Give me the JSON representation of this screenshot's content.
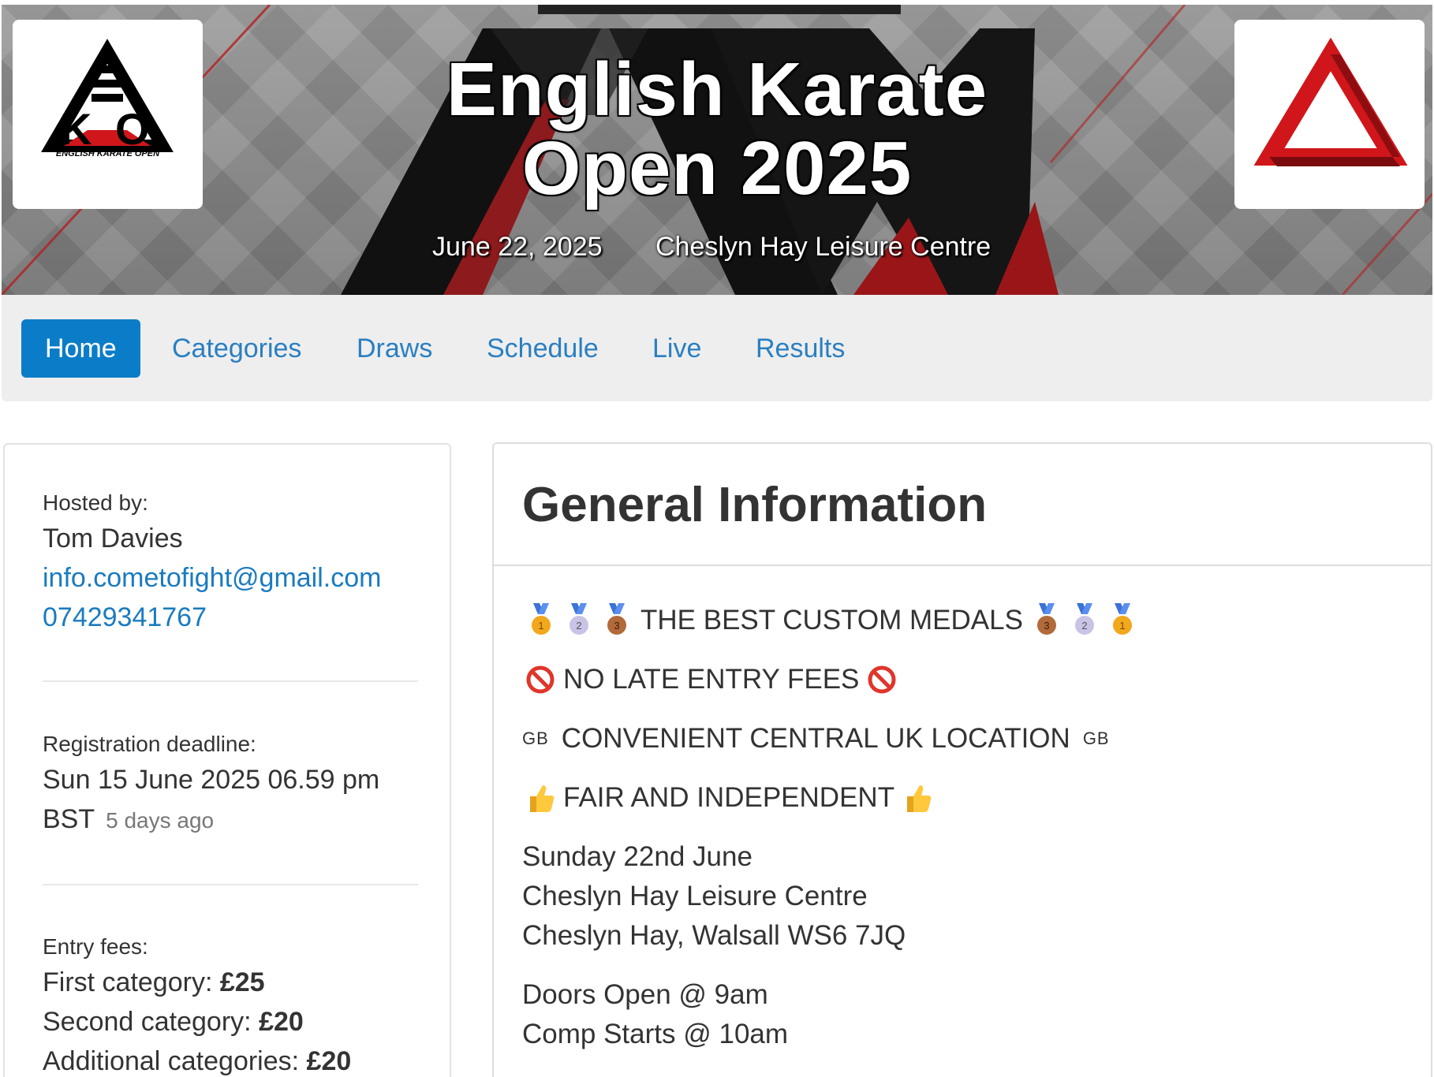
{
  "banner": {
    "title_line1": "English Karate",
    "title_line2": "Open 2025",
    "date": "June 22, 2025",
    "venue": "Cheslyn Hay Leisure Centre",
    "left_logo_caption": "ENGLISH KARATE OPEN",
    "colors": {
      "accent_red": "#d0161b",
      "dark": "#111111"
    }
  },
  "nav": {
    "items": [
      {
        "label": "Home",
        "active": true
      },
      {
        "label": "Categories",
        "active": false
      },
      {
        "label": "Draws",
        "active": false
      },
      {
        "label": "Schedule",
        "active": false
      },
      {
        "label": "Live",
        "active": false
      },
      {
        "label": "Results",
        "active": false
      }
    ],
    "colors": {
      "active_bg": "#0b7dc8",
      "link": "#2a7fc1"
    }
  },
  "sidebar": {
    "hosted_label": "Hosted by:",
    "host_name": "Tom Davies",
    "email": "info.cometofight@gmail.com",
    "phone": "07429341767",
    "deadline_label": "Registration deadline:",
    "deadline_line1": "Sun 15 June 2025 06.59 pm",
    "deadline_line2": "BST",
    "deadline_relative": "5 days ago",
    "fees_label": "Entry fees:",
    "fees": [
      {
        "label": "First category: ",
        "amount": "£25"
      },
      {
        "label": "Second category: ",
        "amount": "£20"
      },
      {
        "label": "Additional categories: ",
        "amount": "£20"
      }
    ]
  },
  "main": {
    "title": "General Information",
    "medals_text": "THE BEST CUSTOM MEDALS",
    "no_late_text": "NO LATE ENTRY FEES",
    "location_flag": "GB",
    "location_text": "CONVENIENT CENTRAL UK LOCATION",
    "fair_text": "FAIR AND INDEPENDENT",
    "event_day": "Sunday 22nd June",
    "venue_name": "Cheslyn Hay Leisure Centre",
    "venue_address": "Cheslyn Hay, Walsall WS6 7JQ",
    "doors_open": "Doors Open @ 9am",
    "comp_starts": "Comp Starts @ 10am",
    "icons": {
      "medal_first": "1st-place-medal-icon",
      "medal_second": "2nd-place-medal-icon",
      "medal_third": "3rd-place-medal-icon",
      "prohibited": "prohibited-icon",
      "thumbs_up": "thumbs-up-icon"
    }
  }
}
